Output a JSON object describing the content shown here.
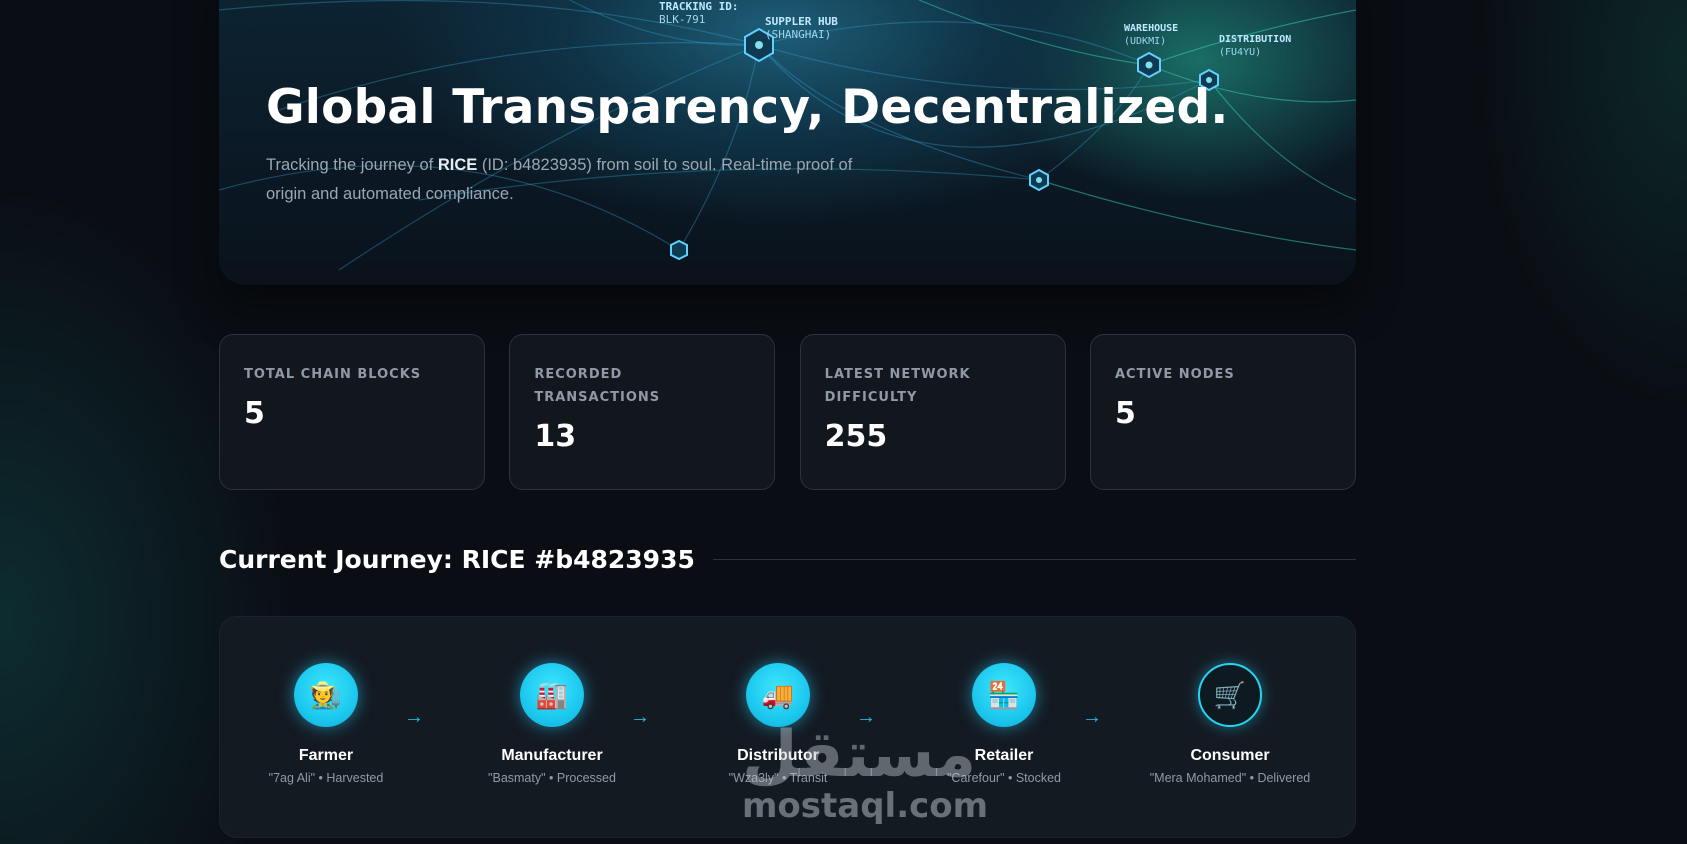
{
  "hero": {
    "title": "Global Transparency, Decentralized.",
    "desc_before": "Tracking the journey of ",
    "product": "RICE",
    "desc_after": " (ID: b4823935) from soil to soul. Real-time proof of origin and automated compliance.",
    "map_tags": [
      {
        "title": "TRACKING ID:",
        "sub": "BLK-791"
      },
      {
        "title": "SUPPLER HUB",
        "sub": "(SHANGHAI)"
      },
      {
        "title": "WAREHOUSE",
        "sub": "(UDKMI)"
      },
      {
        "title": "DISTRIBUTION",
        "sub": "(FU4YU)"
      }
    ]
  },
  "stats": [
    {
      "label": "Total Chain Blocks",
      "value": "5"
    },
    {
      "label": "Recorded Transactions",
      "value": "13"
    },
    {
      "label": "Latest Network Difficulty",
      "value": "255"
    },
    {
      "label": "Active Nodes",
      "value": "5"
    }
  ],
  "journey": {
    "title": "Current Journey: RICE #b4823935",
    "steps": [
      {
        "name": "Farmer",
        "meta": "\"7ag Ali\" • Harvested",
        "icon": "farmer-icon",
        "glyph": "🧑‍🌾"
      },
      {
        "name": "Manufacturer",
        "meta": "\"Basmaty\" • Processed",
        "icon": "factory-icon",
        "glyph": "🏭"
      },
      {
        "name": "Distributor",
        "meta": "\"Wza3ly\" • Transit",
        "icon": "truck-icon",
        "glyph": "🚚"
      },
      {
        "name": "Retailer",
        "meta": "\"Carefour\" • Stocked",
        "icon": "store-icon",
        "glyph": "🏪"
      },
      {
        "name": "Consumer",
        "meta": "\"Mera Mohamed\" • Delivered",
        "icon": "cart-icon",
        "glyph": "🛒"
      }
    ],
    "arrow": "→"
  },
  "watermark": {
    "arabic": "مستقل",
    "latin": "mostaql.com"
  },
  "colors": {
    "accent": "#27d4f0",
    "background": "#0a0e14",
    "card": "#12171e"
  }
}
